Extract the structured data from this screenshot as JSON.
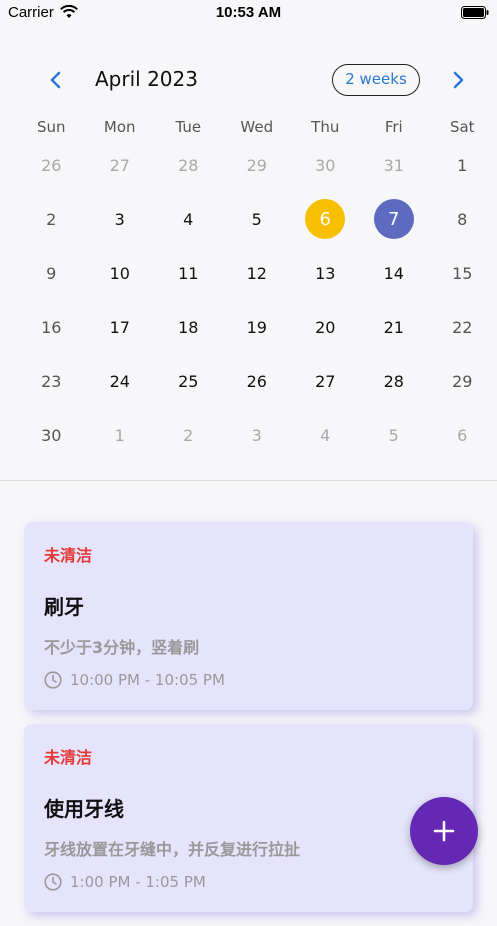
{
  "status_bar": {
    "carrier": "Carrier",
    "time": "10:53 AM"
  },
  "calendar": {
    "month_title": "April 2023",
    "format_button": "2 weeks",
    "weekdays": [
      "Sun",
      "Mon",
      "Tue",
      "Wed",
      "Thu",
      "Fri",
      "Sat"
    ],
    "weeks": [
      [
        "26",
        "27",
        "28",
        "29",
        "30",
        "31",
        "1"
      ],
      [
        "2",
        "3",
        "4",
        "5",
        "6",
        "7",
        "8"
      ],
      [
        "9",
        "10",
        "11",
        "12",
        "13",
        "14",
        "15"
      ],
      [
        "16",
        "17",
        "18",
        "19",
        "20",
        "21",
        "22"
      ],
      [
        "23",
        "24",
        "25",
        "26",
        "27",
        "28",
        "29"
      ],
      [
        "30",
        "1",
        "2",
        "3",
        "4",
        "5",
        "6"
      ]
    ],
    "today_color": "#f8bf00",
    "selected_color": "#5c6bc0"
  },
  "events": [
    {
      "status": "未清洁",
      "title": "刷牙",
      "description": "不少于3分钟，竖着刷",
      "time": "10:00 PM - 10:05 PM"
    },
    {
      "status": "未清洁",
      "title": "使用牙线",
      "description": "牙线放置在牙缝中，并反复进行拉扯",
      "time": "1:00 PM - 1:05 PM"
    }
  ],
  "fab": {
    "icon": "plus-icon",
    "color": "#6428b4"
  }
}
